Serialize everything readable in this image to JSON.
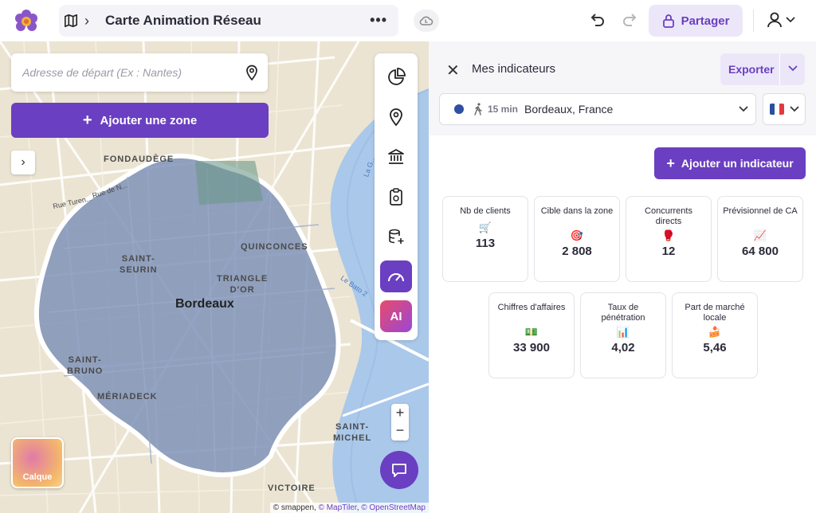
{
  "header": {
    "title": "Carte Animation Réseau",
    "share_label": "Partager"
  },
  "map": {
    "address_placeholder": "Adresse de départ (Ex : Nantes)",
    "add_zone_label": "Ajouter une zone",
    "layer_label": "Calque",
    "ai_label": "AI",
    "labels": {
      "fondaudege": "FONDAUDÈGE",
      "rue_turenne": "Rue Turen...",
      "rue_naujac": "Rue de N...",
      "saint_seurin": "SAINT-\nSEURIN",
      "quinconces": "QUINCONCES",
      "triangle": "TRIANGLE\nD'OR",
      "bordeaux": "Bordeaux",
      "saint_bruno": "SAINT-\nBRUNO",
      "meriadeck": "MÉRIADECK",
      "saint_michel": "SAINT-\nMICHEL",
      "victoire": "VICTOIRE",
      "le_bato": "Le Bato 2",
      "la_garonne": "La G..."
    },
    "attribution": {
      "prefix": "© smappen, ",
      "maptiler": "© MapTiler",
      "sep": ", ",
      "osm": "© OpenStreetMap"
    }
  },
  "panel": {
    "title": "Mes indicateurs",
    "export_label": "Exporter",
    "location": {
      "duration": "15 min",
      "place": "Bordeaux, France"
    },
    "add_indicator_label": "Ajouter un indicateur",
    "cards": [
      {
        "label": "Nb de clients",
        "icon": "🛒",
        "value": "113"
      },
      {
        "label": "Cible dans la zone",
        "icon": "🎯",
        "value": "2 808"
      },
      {
        "label": "Concurrents directs",
        "icon": "🥊",
        "value": "12"
      },
      {
        "label": "Prévisionnel de CA",
        "icon": "📈",
        "value": "64 800"
      },
      {
        "label": "Chiffres d'affaires",
        "icon": "💵",
        "value": "33 900"
      },
      {
        "label": "Taux de pénétration",
        "icon": "📊",
        "value": "4,02"
      },
      {
        "label": "Part de marché locale",
        "icon": "🍰",
        "value": "5,46"
      }
    ]
  },
  "colors": {
    "accent": "#6a3fc1",
    "accent_light": "#ece7f8",
    "zone_fill": "#7f93b8",
    "river": "#aac8ea"
  }
}
